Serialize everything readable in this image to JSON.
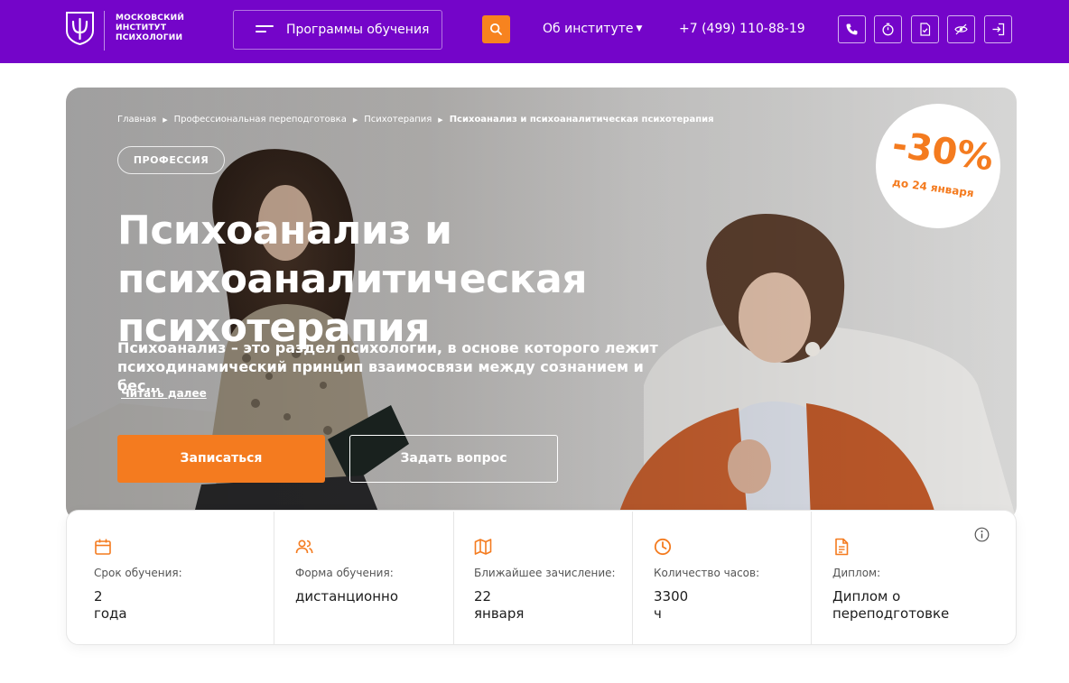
{
  "header": {
    "logo": {
      "icon": "psi-logo-icon",
      "lines": [
        "МОСКОВСКИЙ",
        "ИНСТИТУТ",
        "ПСИХОЛОГИИ"
      ]
    },
    "programs_label": "Программы обучения",
    "search_icon": "search-icon",
    "about_label": "Об институте",
    "phone": "+7 (499) 110-88-19",
    "icons": [
      "phone-icon",
      "timer-icon",
      "document-check-icon",
      "accessibility-eye-icon",
      "login-icon"
    ]
  },
  "colors": {
    "header_bg": "#7405c9",
    "accent": "#f47b1f",
    "text_dark": "#1d1d1d"
  },
  "hero": {
    "breadcrumb": [
      "Главная",
      "Профессиональная переподготовка",
      "Психотерапия",
      "Психоанализ и психоаналитическая психотерапия"
    ],
    "tag": "ПРОФЕССИЯ",
    "title_line1": "Психоанализ и психоаналитическая",
    "title_line2": "психотерапия",
    "desc_line1": "Психоанализ – это раздел психологии, в основе которого лежит",
    "desc_line2": "психодинамический принцип взаимосвязи между сознанием и бес…",
    "read_more": "Читать далее",
    "enroll_button": "Записаться",
    "question_button": "Задать вопрос",
    "discount": {
      "value": "-30%",
      "until": "до 24 января"
    }
  },
  "info": {
    "items": [
      {
        "icon": "calendar-icon",
        "label": "Срок обучения:",
        "value": "2 года"
      },
      {
        "icon": "users-icon",
        "label": "Форма обучения:",
        "value": "дистанционно"
      },
      {
        "icon": "map-icon",
        "label": "Ближайшее зачисление:",
        "value": "22 января"
      },
      {
        "icon": "clock-icon",
        "label": "Количество часов:",
        "value": "3300 ч"
      },
      {
        "icon": "document-icon",
        "label": "Диплом:",
        "value_line1": "Диплом о",
        "value_line2": "переподготовке"
      }
    ],
    "info_icon": "info-icon"
  }
}
